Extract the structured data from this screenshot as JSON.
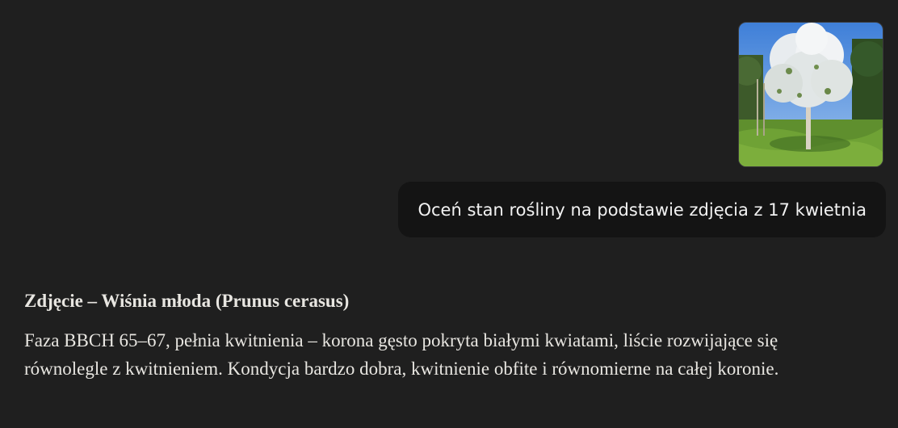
{
  "conversation": {
    "user_message": {
      "attachment": {
        "kind": "image",
        "icon": "cherry-tree-photo"
      },
      "text": "Oceń stan rośliny na podstawie zdjęcia z 17 kwietnia"
    },
    "assistant_message": {
      "heading": "Zdjęcie – Wiśnia młoda (Prunus cerasus)",
      "body": "Faza BBCH 65–67, pełnia kwitnienia – korona gęsto pokryta białymi kwiatami, liście rozwijające się równolegle z kwitnieniem. Kondycja bardzo dobra, kwitnienie obfite i równomierne na całej koronie."
    }
  },
  "colors": {
    "background": "#1f1f1f",
    "user_bubble": "#141414",
    "text": "#ececec"
  }
}
